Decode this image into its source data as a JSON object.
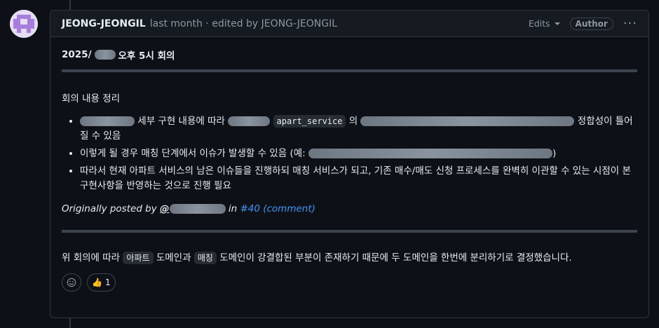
{
  "comment": {
    "author": "JEONG-JEONGIL",
    "meta": "last month · edited by JEONG-JEONGIL",
    "edits_label": "Edits",
    "author_badge": "Author",
    "more_label": "···",
    "title_prefix": "2025/",
    "title_suffix": "오후 5시 회의",
    "section_heading": "회의 내용 정리",
    "bullets": [
      {
        "t1": "세부 구현 내용에 따라",
        "code": "apart_service",
        "t2": "의",
        "t3": "정합성이 틀어질 수 있음"
      },
      {
        "t1": "이렇게 될 경우 매칭 단계에서 이슈가 발생할 수 있음 (예:",
        "t2": ")"
      },
      {
        "t1": "따라서 현재 아파트 서비스의 남은 이슈들을 진행하되 매칭 서비스가 되고, 기존 매수/매도 신청 프로세스를 완벽히 이관할 수 있는 시점이 본 구현사항을 반영하는 것으로 진행 필요"
      }
    ],
    "posted_prefix": "Originally posted by",
    "posted_mention": "@",
    "posted_in": "in",
    "posted_link": "#40 (comment)",
    "conclusion_t1": "위 회의에 따라",
    "conclusion_code1": "아파트",
    "conclusion_t2": "도메인과",
    "conclusion_code2": "매칭",
    "conclusion_t3": "도메인이 강결합된 부분이 존재하기 때문에 두 도메인을 한번에 분리하기로 결정했습니다.",
    "reaction_emoji": "👍",
    "reaction_count": "1",
    "add_reaction_icon": "smiley-icon"
  }
}
